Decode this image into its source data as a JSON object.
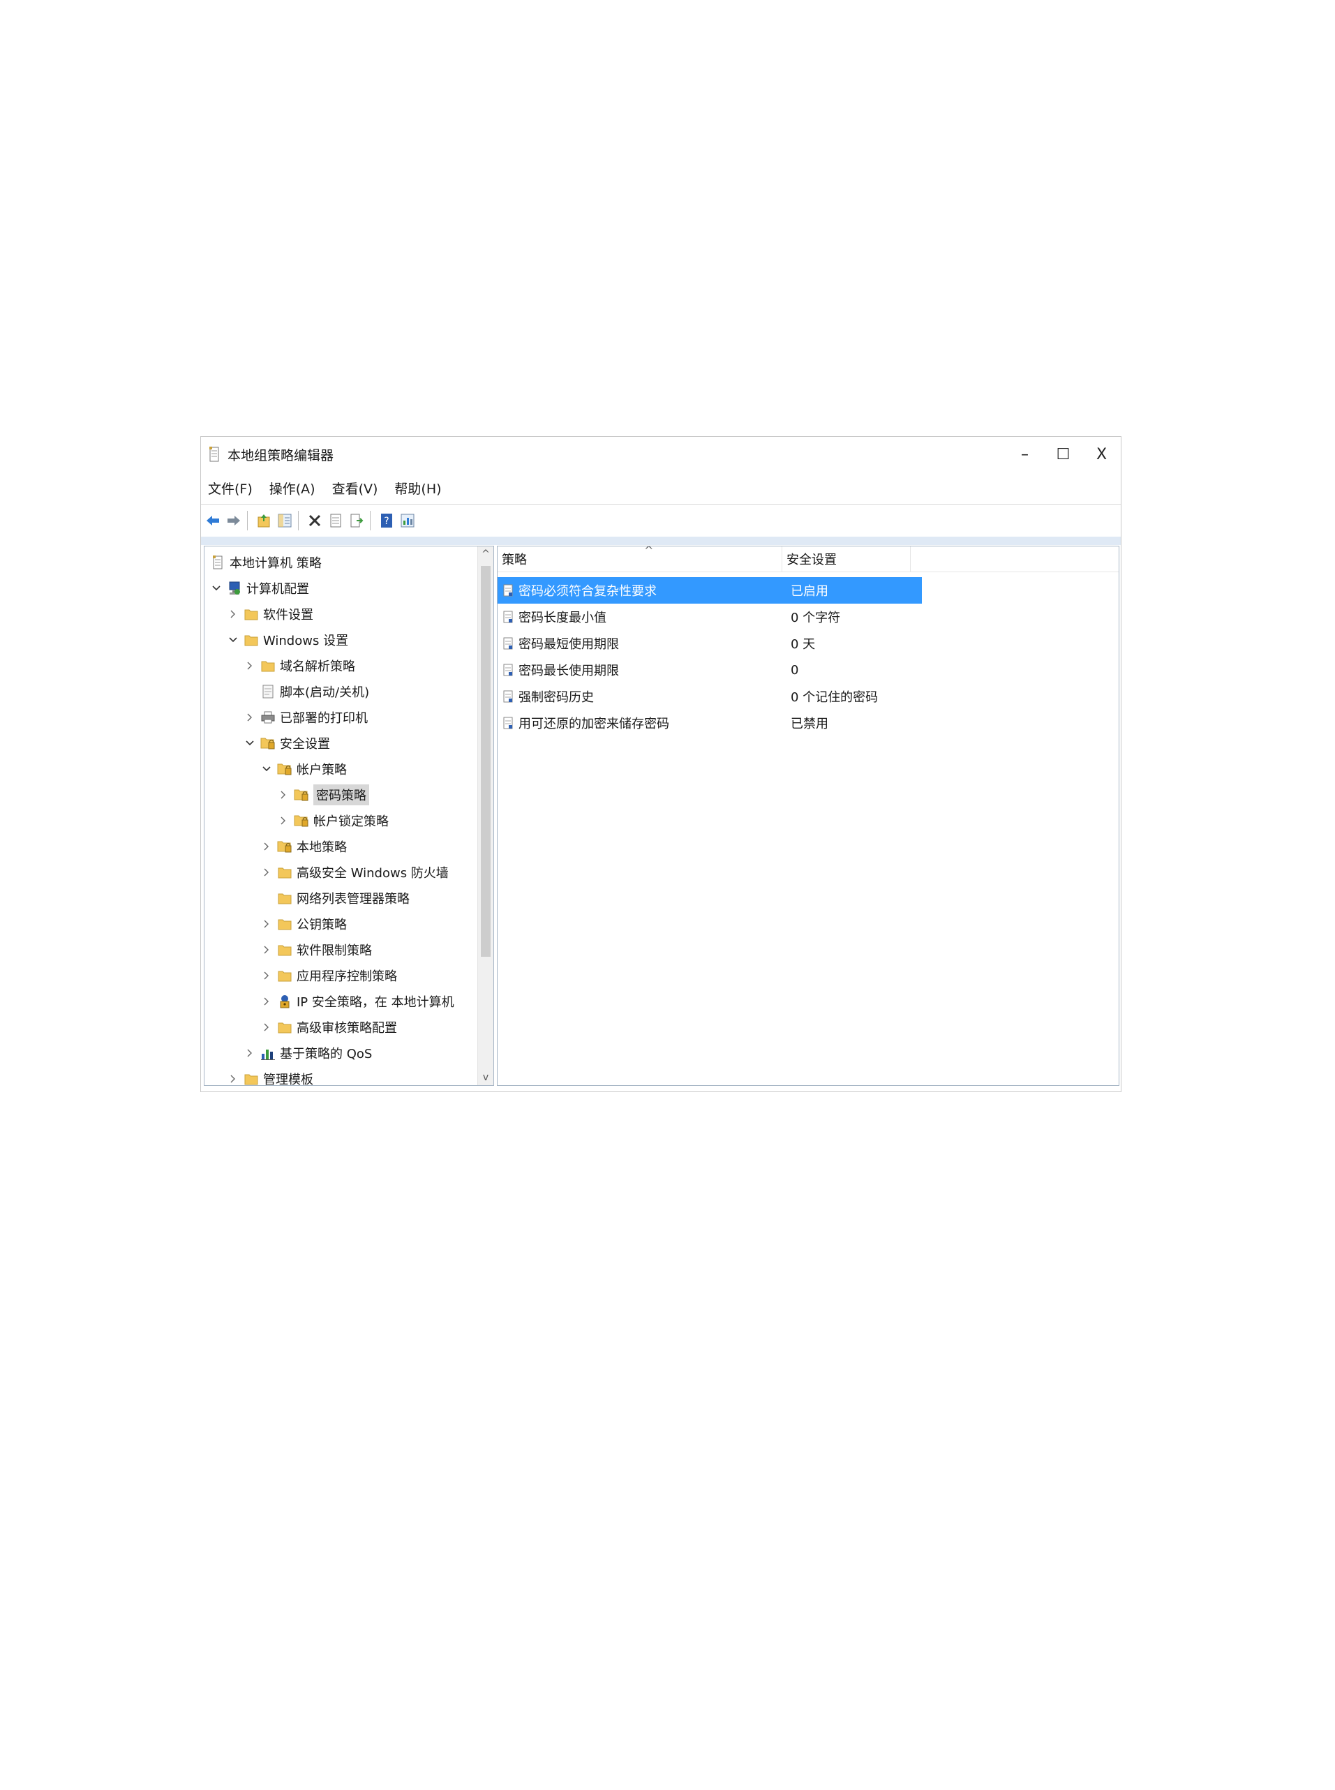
{
  "window": {
    "title": "本地组策略编辑器",
    "controls": {
      "minimize": "–",
      "maximize": "☐",
      "close": "X"
    }
  },
  "menu": [
    "文件(F)",
    "操作(A)",
    "查看(V)",
    "帮助(H)"
  ],
  "tree": {
    "items": [
      {
        "label": "本地计算机 策略",
        "icon": "policy-doc-icon",
        "chevron": ""
      },
      {
        "label": "计算机配置",
        "icon": "computer-config-icon",
        "chevron": "v"
      },
      {
        "label": "软件设置",
        "icon": "folder-icon",
        "chevron": ">"
      },
      {
        "label": "Windows 设置",
        "icon": "folder-icon",
        "chevron": "v"
      },
      {
        "label": "域名解析策略",
        "icon": "folder-icon",
        "chevron": ">"
      },
      {
        "label": "脚本(启动/关机)",
        "icon": "script-icon",
        "chevron": ""
      },
      {
        "label": "已部署的打印机",
        "icon": "printer-icon",
        "chevron": ">"
      },
      {
        "label": "安全设置",
        "icon": "security-folder-icon",
        "chevron": "v"
      },
      {
        "label": "帐户策略",
        "icon": "security-folder-icon",
        "chevron": "v"
      },
      {
        "label": "密码策略",
        "icon": "security-folder-icon",
        "chevron": ">",
        "selected": true
      },
      {
        "label": "帐户锁定策略",
        "icon": "security-folder-icon",
        "chevron": ">"
      },
      {
        "label": "本地策略",
        "icon": "security-folder-icon",
        "chevron": ">"
      },
      {
        "label": "高级安全 Windows 防火墙",
        "icon": "folder-icon",
        "chevron": ">"
      },
      {
        "label": "网络列表管理器策略",
        "icon": "folder-icon",
        "chevron": ""
      },
      {
        "label": "公钥策略",
        "icon": "folder-icon",
        "chevron": ">"
      },
      {
        "label": "软件限制策略",
        "icon": "folder-icon",
        "chevron": ">"
      },
      {
        "label": "应用程序控制策略",
        "icon": "folder-icon",
        "chevron": ">"
      },
      {
        "label": "IP 安全策略，在 本地计算机",
        "icon": "ip-security-icon",
        "chevron": ">"
      },
      {
        "label": "高级审核策略配置",
        "icon": "folder-icon",
        "chevron": ">"
      },
      {
        "label": "基于策略的 QoS",
        "icon": "qos-chart-icon",
        "chevron": ">"
      },
      {
        "label": "管理模板",
        "icon": "folder-icon",
        "chevron": ">"
      }
    ],
    "scroll": {
      "up": "^",
      "down": "v"
    }
  },
  "list": {
    "columns": [
      "策略",
      "安全设置"
    ],
    "sort_indicator": "^",
    "rows": [
      {
        "policy": "密码必须符合复杂性要求",
        "setting": "已启用",
        "selected": true
      },
      {
        "policy": "密码长度最小值",
        "setting": "0 个字符"
      },
      {
        "policy": "密码最短使用期限",
        "setting": "0 天"
      },
      {
        "policy": "密码最长使用期限",
        "setting": "0"
      },
      {
        "policy": "强制密码历史",
        "setting": "0 个记住的密码"
      },
      {
        "policy": "用可还原的加密来储存密码",
        "setting": "已禁用"
      }
    ]
  },
  "colors": {
    "selection": "#3399ff",
    "tree_selection": "#d7d7d7",
    "folder": "#f3c75a"
  }
}
